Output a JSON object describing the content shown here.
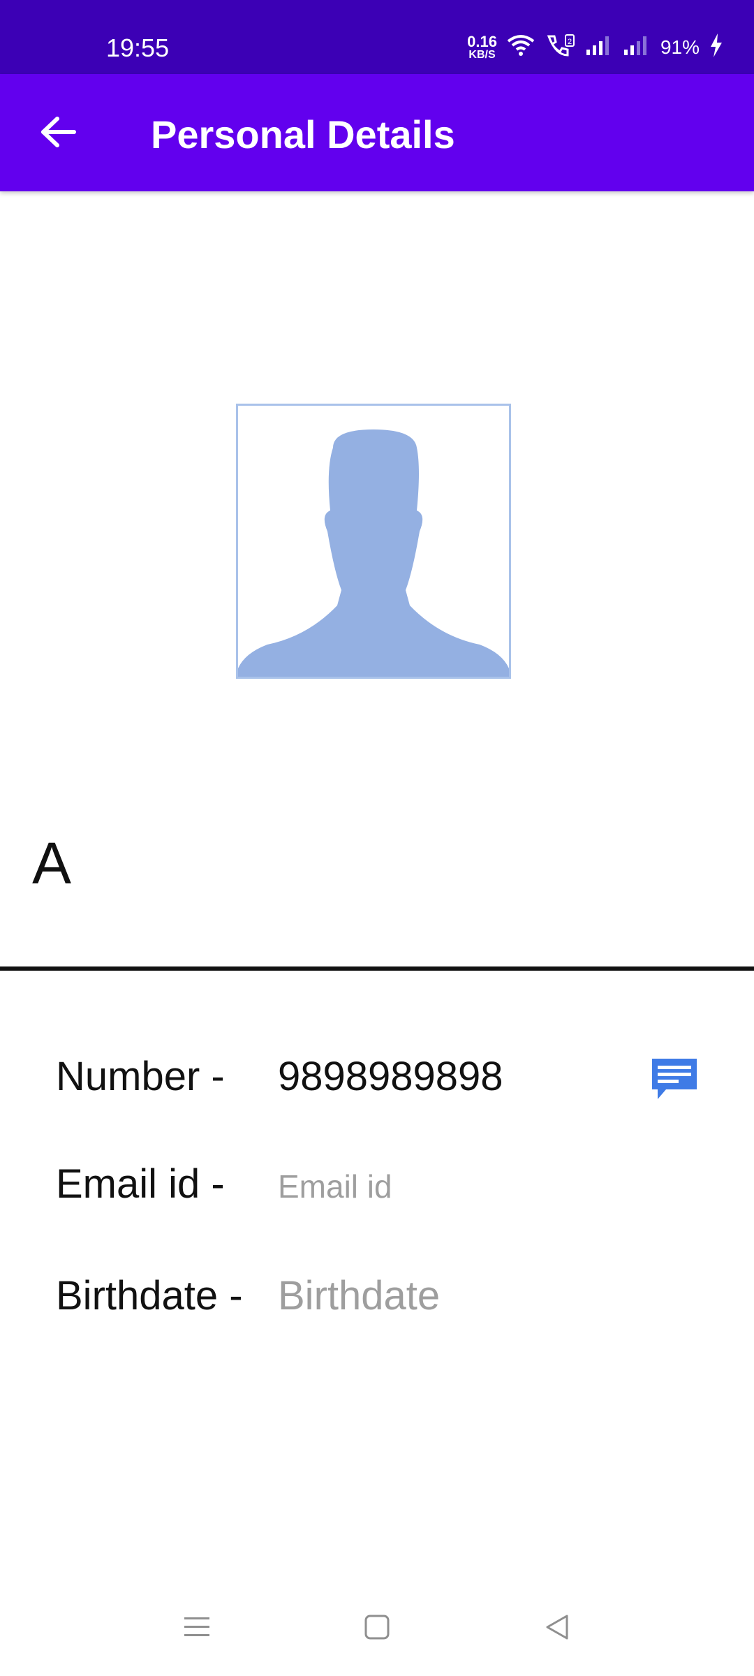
{
  "status_bar": {
    "time": "19:55",
    "net_speed_value": "0.16",
    "net_speed_unit": "KB/S",
    "battery": "91%",
    "icons": [
      "wifi-icon",
      "vowifi-call-icon",
      "signal-icon",
      "signal-icon",
      "charging-icon"
    ]
  },
  "app_bar": {
    "title": "Personal Details",
    "back_icon": "arrow-left-icon",
    "background": "#6200ee"
  },
  "profile": {
    "photo_icon": "person-silhouette-icon",
    "photo_color": "#94b0e2",
    "name": "A"
  },
  "details": {
    "number_label": "Number -",
    "number_value": "9898989898",
    "email_label": "Email id -",
    "email_placeholder": "Email id",
    "birthdate_label": "Birthdate -",
    "birthdate_placeholder": "Birthdate",
    "message_icon": "message-icon",
    "message_icon_color": "#3f7be6"
  },
  "nav_bar": {
    "icons": [
      "menu-icon",
      "home-icon",
      "back-triangle-icon"
    ]
  }
}
